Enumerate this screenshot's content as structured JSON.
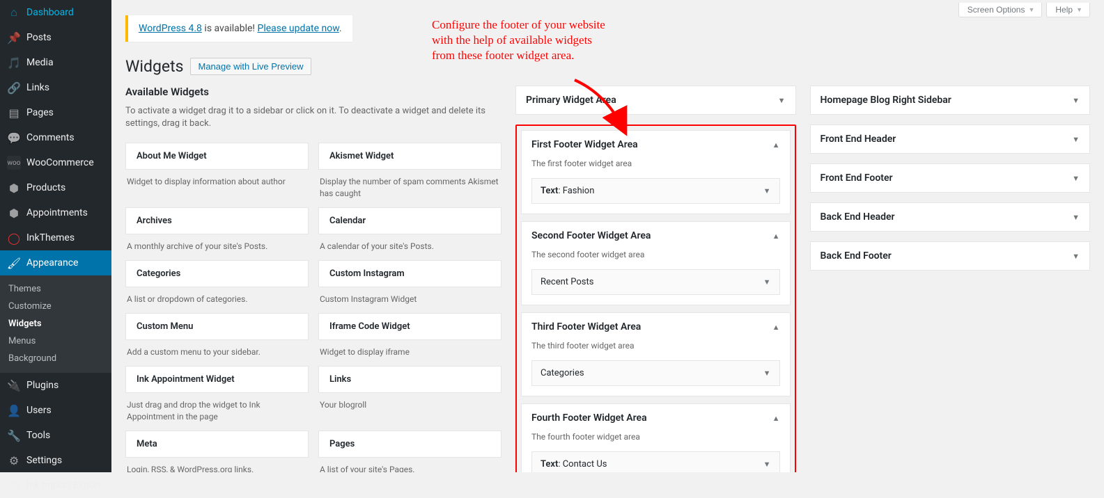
{
  "screenMeta": {
    "screenOptions": "Screen Options",
    "help": "Help"
  },
  "sidebar": {
    "items": [
      {
        "icon": "dashboard",
        "label": "Dashboard"
      },
      {
        "icon": "pin",
        "label": "Posts"
      },
      {
        "icon": "media",
        "label": "Media"
      },
      {
        "icon": "link",
        "label": "Links"
      },
      {
        "icon": "page",
        "label": "Pages"
      },
      {
        "icon": "comments",
        "label": "Comments"
      },
      {
        "icon": "woo",
        "label": "WooCommerce"
      },
      {
        "icon": "products",
        "label": "Products"
      },
      {
        "icon": "appointments",
        "label": "Appointments"
      },
      {
        "icon": "inkthemes",
        "label": "InkThemes"
      },
      {
        "icon": "appearance",
        "label": "Appearance",
        "current": true
      },
      {
        "icon": "plugins",
        "label": "Plugins"
      },
      {
        "icon": "users",
        "label": "Users"
      },
      {
        "icon": "tools",
        "label": "Tools"
      },
      {
        "icon": "settings",
        "label": "Settings"
      },
      {
        "icon": "importexport",
        "label": "Ink Import Export"
      }
    ],
    "sub": [
      {
        "label": "Themes"
      },
      {
        "label": "Customize"
      },
      {
        "label": "Widgets",
        "current": true
      },
      {
        "label": "Menus"
      },
      {
        "label": "Background"
      }
    ]
  },
  "updateNag": {
    "versionLink": "WordPress 4.8",
    "middle": " is available! ",
    "actionLink": "Please update now"
  },
  "page": {
    "title": "Widgets",
    "action": "Manage with Live Preview"
  },
  "available": {
    "title": "Available Widgets",
    "desc": "To activate a widget drag it to a sidebar or click on it. To deactivate a widget and delete its settings, drag it back.",
    "widgets": [
      {
        "title": "About Me Widget",
        "desc": "Widget to display information about author"
      },
      {
        "title": "Akismet Widget",
        "desc": "Display the number of spam comments Akismet has caught"
      },
      {
        "title": "Archives",
        "desc": "A monthly archive of your site's Posts."
      },
      {
        "title": "Calendar",
        "desc": "A calendar of your site's Posts."
      },
      {
        "title": "Categories",
        "desc": "A list or dropdown of categories."
      },
      {
        "title": "Custom Instagram",
        "desc": "Custom Instagram Widget"
      },
      {
        "title": "Custom Menu",
        "desc": "Add a custom menu to your sidebar."
      },
      {
        "title": "Iframe Code Widget",
        "desc": "Widget to display iframe"
      },
      {
        "title": "Ink Appointment Widget",
        "desc": "Just drag and drop the widget to Ink Appointment in the page"
      },
      {
        "title": "Links",
        "desc": "Your blogroll"
      },
      {
        "title": "Meta",
        "desc": "Login, RSS, & WordPress.org links."
      },
      {
        "title": "Pages",
        "desc": "A list of your site's Pages."
      }
    ]
  },
  "midColumn": {
    "primary": {
      "title": "Primary Widget Area"
    },
    "footerAreas": [
      {
        "title": "First Footer Widget Area",
        "desc": "The first footer widget area",
        "widget": {
          "type": "Text",
          "title": "Fashion"
        }
      },
      {
        "title": "Second Footer Widget Area",
        "desc": "The second footer widget area",
        "widget": {
          "type": "Recent Posts",
          "title": ""
        }
      },
      {
        "title": "Third Footer Widget Area",
        "desc": "The third footer widget area",
        "widget": {
          "type": "Categories",
          "title": ""
        }
      },
      {
        "title": "Fourth Footer Widget Area",
        "desc": "The fourth footer widget area",
        "widget": {
          "type": "Text",
          "title": "Contact Us"
        }
      }
    ]
  },
  "rightColumn": {
    "areas": [
      {
        "title": "Homepage Blog Right Sidebar"
      },
      {
        "title": "Front End Header"
      },
      {
        "title": "Front End Footer"
      },
      {
        "title": "Back End Header"
      },
      {
        "title": "Back End Footer"
      }
    ]
  },
  "annotation": {
    "text": "Configure the footer of your website with the help of available widgets from these footer widget area."
  },
  "icons": {
    "dashboard": "⌂",
    "pin": "📌",
    "media": "🎵",
    "link": "🔗",
    "page": "▤",
    "comments": "💬",
    "woo": "woo",
    "products": "⬢",
    "appointments": "⬢",
    "inkthemes": "◯",
    "appearance": "🖌",
    "plugins": "🔌",
    "users": "👤",
    "tools": "🔧",
    "settings": "⚙",
    "importexport": "⚙"
  }
}
